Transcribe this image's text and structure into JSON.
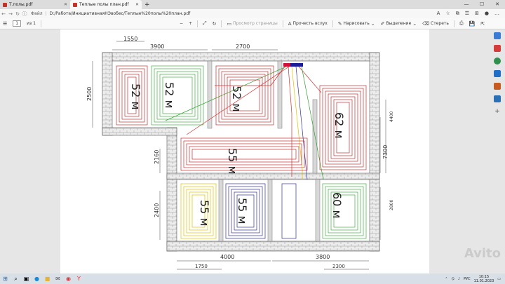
{
  "tabs": [
    {
      "label": "Т.полы.pdf"
    },
    {
      "label": "Теплые полы план.pdf"
    }
  ],
  "address": {
    "file_label": "Файл",
    "path": "D:/Работа/ИнициативнаяНЭвобес/Теплые%20полы%20план.pdf"
  },
  "toolbar": {
    "page_current": "1",
    "page_total": "из 1",
    "zoom_out": "−",
    "zoom_in": "+",
    "view_pages": "Просмотр страницы",
    "read_aloud": "Прочесть вслух",
    "draw": "Нарисовать",
    "highlight": "Выделение",
    "erase": "Стереть"
  },
  "plan": {
    "dimensions": {
      "top_1550": "1550",
      "top_3900": "3900",
      "top_2700": "2700",
      "left_2500": "2500",
      "left_2160": "2160",
      "left_2400": "2400",
      "right_4400": "4400",
      "right_7300": "7300",
      "right_2800": "2800",
      "bottom_4000": "4000",
      "bottom_3800": "3800",
      "bottom_1750": "1750",
      "bottom_2300": "2300"
    },
    "loops": {
      "l1": "52 м",
      "l2": "52 м",
      "l3": "52 м",
      "l4": "62 м",
      "l5": "55 м",
      "l6": "55 м",
      "l7": "55 м",
      "l8": "60 м"
    }
  },
  "taskbar": {
    "lang": "РУС",
    "time": "10:15",
    "date": "11.01.2023"
  },
  "watermark": "Avito"
}
